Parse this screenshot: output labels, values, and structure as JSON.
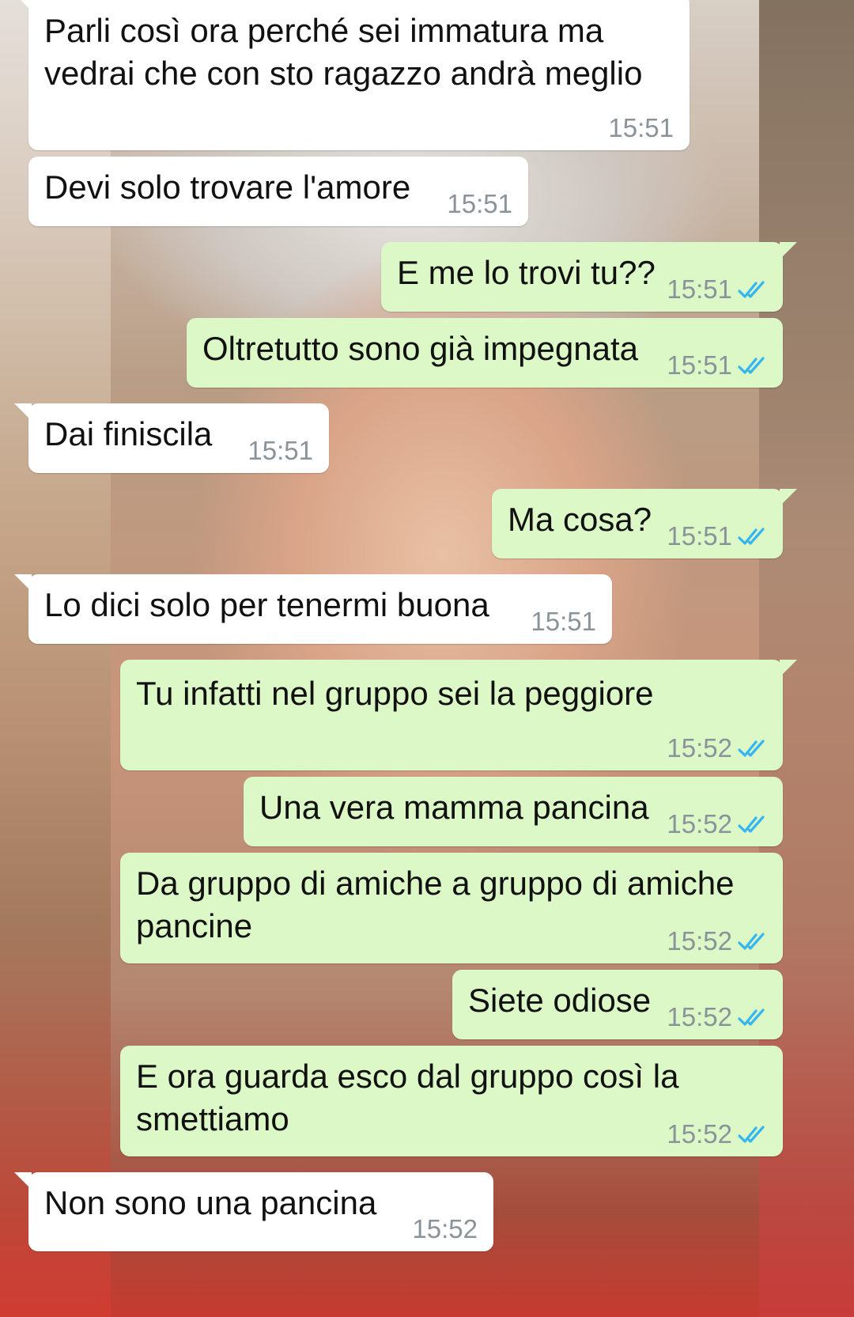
{
  "colors": {
    "incoming_bubble": "#ffffff",
    "outgoing_bubble": "#dcf8c6",
    "timestamp": "#8a9399",
    "read_ticks": "#34b7f1"
  },
  "messages": [
    {
      "dir": "in",
      "text": [
        "Parli così ora perché sei immatura ma",
        "vedrai che con sto ragazzo andrà meglio"
      ],
      "time": "15:51"
    },
    {
      "dir": "in",
      "text": [
        "Devi solo trovare l'amore"
      ],
      "time": "15:51"
    },
    {
      "dir": "out",
      "text": [
        "E me lo trovi tu??"
      ],
      "time": "15:51",
      "status_icon": "double-check-icon"
    },
    {
      "dir": "out",
      "text": [
        "Oltretutto sono già impegnata"
      ],
      "time": "15:51",
      "status_icon": "double-check-icon"
    },
    {
      "dir": "in",
      "text": [
        "Dai finiscila"
      ],
      "time": "15:51"
    },
    {
      "dir": "out",
      "text": [
        "Ma cosa?"
      ],
      "time": "15:51",
      "status_icon": "double-check-icon"
    },
    {
      "dir": "in",
      "text": [
        "Lo dici solo per tenermi buona"
      ],
      "time": "15:51"
    },
    {
      "dir": "out",
      "text": [
        "Tu infatti nel gruppo sei la peggiore"
      ],
      "time": "15:52",
      "status_icon": "double-check-icon"
    },
    {
      "dir": "out",
      "text": [
        "Una vera mamma pancina"
      ],
      "time": "15:52",
      "status_icon": "double-check-icon"
    },
    {
      "dir": "out",
      "text": [
        "Da gruppo di amiche a gruppo di amiche",
        "pancine"
      ],
      "time": "15:52",
      "status_icon": "double-check-icon"
    },
    {
      "dir": "out",
      "text": [
        "Siete odiose"
      ],
      "time": "15:52",
      "status_icon": "double-check-icon"
    },
    {
      "dir": "out",
      "text": [
        "E ora guarda esco dal gruppo così la",
        "smettiamo"
      ],
      "time": "15:52",
      "status_icon": "double-check-icon"
    },
    {
      "dir": "in",
      "text": [
        "Non sono una pancina"
      ],
      "time": "15:52"
    }
  ]
}
